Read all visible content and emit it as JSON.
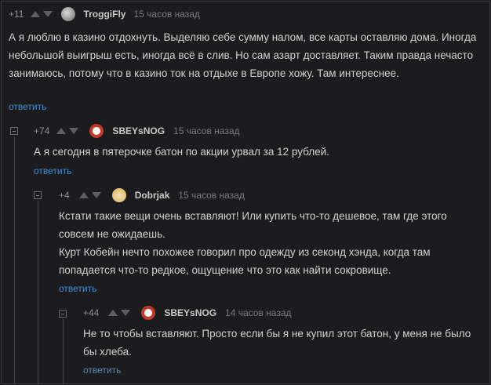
{
  "comments": [
    {
      "rating": "+11",
      "username": "TroggiFly",
      "time": "15 часов назад",
      "text": "А я люблю в казино отдохнуть. Выделяю себе сумму налом, все карты оставляю дома. Иногда небольшой выигрыш есть, иногда всё в слив. Но сам азарт доставляет. Таким правда нечасто занимаюсь, потому что в казино ток на отдыхе в Европе хожу. Там интереснее.",
      "reply": "ответить",
      "avatar_icon": "globe-avatar-icon"
    },
    {
      "rating": "+74",
      "username": "SBEYsNOG",
      "time": "15 часов назад",
      "text": "А я сегодня в пятерочке батон по акции урвал за 12 рублей.",
      "reply": "ответить",
      "avatar_icon": "red-emblem-avatar-icon"
    },
    {
      "rating": "+4",
      "username": "Dobrjak",
      "time": "15 часов назад",
      "text": "Кстати такие вещи очень вставляют! Или купить что-то дешевое, там где этого совсем не ожидаешь.\nКурт Кобейн нечто похожее говорил про одежду из секонд хэнда, когда там попадается что-то редкое, ощущение что это как найти сокровище.",
      "reply": "ответить",
      "avatar_icon": "cat-avatar-icon"
    },
    {
      "rating": "+44",
      "username": "SBEYsNOG",
      "time": "14 часов назад",
      "text": "Не то чтобы вставляют. Просто если бы я не купил этот батон, у меня не было бы хлеба.",
      "reply": "ответить",
      "avatar_icon": "red-emblem-avatar-icon"
    }
  ],
  "colors": {
    "background": "#1c1c1e",
    "text": "#d2d2d2",
    "link": "#4a8cc9",
    "username": "#c9c9c9"
  }
}
